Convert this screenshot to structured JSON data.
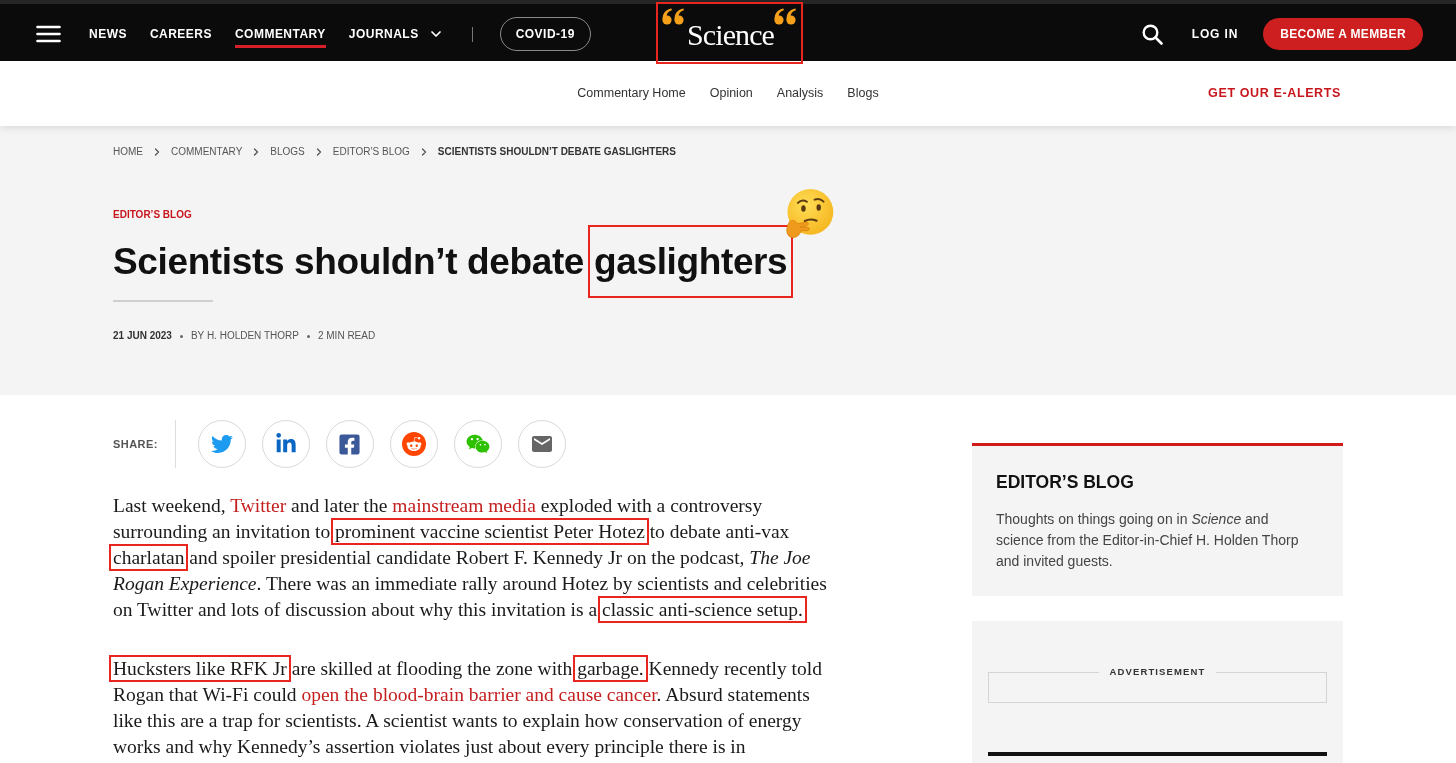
{
  "top_nav": {
    "items": [
      {
        "label": "NEWS",
        "selected": false,
        "dropdown": false
      },
      {
        "label": "CAREERS",
        "selected": false,
        "dropdown": false
      },
      {
        "label": "COMMENTARY",
        "selected": true,
        "dropdown": false
      },
      {
        "label": "JOURNALS",
        "selected": false,
        "dropdown": true
      }
    ],
    "topic_pill": "COVID-19",
    "logo": {
      "text": "Science",
      "boxed": true
    },
    "login": "LOG IN",
    "member_button": "BECOME A MEMBER"
  },
  "sub_nav": {
    "items": [
      "Commentary Home",
      "Opinion",
      "Analysis",
      "Blogs"
    ],
    "alerts_link": "GET OUR E-ALERTS"
  },
  "breadcrumb": [
    {
      "label": "HOME",
      "current": false
    },
    {
      "label": "COMMENTARY",
      "current": false
    },
    {
      "label": "BLOGS",
      "current": false
    },
    {
      "label": "EDITOR’S BLOG",
      "current": false
    },
    {
      "label": "SCIENTISTS SHOULDN’T DEBATE GASLIGHTERS",
      "current": true
    }
  ],
  "article": {
    "category": "EDITOR’S BLOG",
    "title": [
      {
        "text": "Scientists shouldn’t debate ",
        "boxed": false
      },
      {
        "text": "gaslighters",
        "boxed": true
      }
    ],
    "date": "21 JUN 2023",
    "byline": "BY H. HOLDEN THORP",
    "read_time": "2 MIN READ",
    "share": {
      "label": "SHARE:",
      "buttons": [
        {
          "kind": "twitter"
        },
        {
          "kind": "linkedin"
        },
        {
          "kind": "facebook"
        },
        {
          "kind": "reddit"
        },
        {
          "kind": "wechat"
        },
        {
          "kind": "email"
        }
      ]
    },
    "paragraphs": [
      [
        {
          "kind": "plain",
          "text": "Last weekend, ",
          "boxed": false
        },
        {
          "kind": "link",
          "text": "Twitter",
          "boxed": false
        },
        {
          "kind": "plain",
          "text": " and later the ",
          "boxed": false
        },
        {
          "kind": "link",
          "text": "mainstream media",
          "boxed": false
        },
        {
          "kind": "plain",
          "text": " exploded with a controversy surrounding an invitation to ",
          "boxed": false
        },
        {
          "kind": "plain",
          "text": "prominent vaccine scientist Peter Hotez",
          "boxed": true
        },
        {
          "kind": "plain",
          "text": " to debate anti-vax ",
          "boxed": false
        },
        {
          "kind": "plain",
          "text": "charlatan",
          "boxed": true
        },
        {
          "kind": "plain",
          "text": " and spoiler presidential candidate Robert F. Kennedy Jr on the podcast, ",
          "boxed": false
        },
        {
          "kind": "italic",
          "text": "The Joe Rogan Experience",
          "boxed": false
        },
        {
          "kind": "plain",
          "text": ". There was an immediate rally around Hotez by scientists and celebrities on Twitter and lots of discussion about why this invitation is a ",
          "boxed": false
        },
        {
          "kind": "plain",
          "text": "classic anti-science setup.",
          "boxed": true
        }
      ],
      [
        {
          "kind": "plain",
          "text": "Hucksters like RFK Jr",
          "boxed": true
        },
        {
          "kind": "plain",
          "text": " are skilled at flooding the zone with ",
          "boxed": false
        },
        {
          "kind": "plain",
          "text": "garbage.",
          "boxed": true
        },
        {
          "kind": "plain",
          "text": " Kennedy recently told Rogan that Wi-Fi could ",
          "boxed": false
        },
        {
          "kind": "link",
          "text": "open the blood-brain barrier and cause cancer",
          "boxed": false
        },
        {
          "kind": "plain",
          "text": ". Absurd statements like this are a trap for scientists. A scientist wants to explain how conservation of energy works and why Kennedy’s assertion violates just about every principle there is in",
          "boxed": false
        }
      ]
    ]
  },
  "sidebar": {
    "blog_card": {
      "title": "EDITOR’S BLOG",
      "description": "Thoughts on things going on in *Science* and science from the Editor-in-Chief H. Holden Thorp and invited guests."
    },
    "ad_label": "ADVERTISEMENT"
  }
}
